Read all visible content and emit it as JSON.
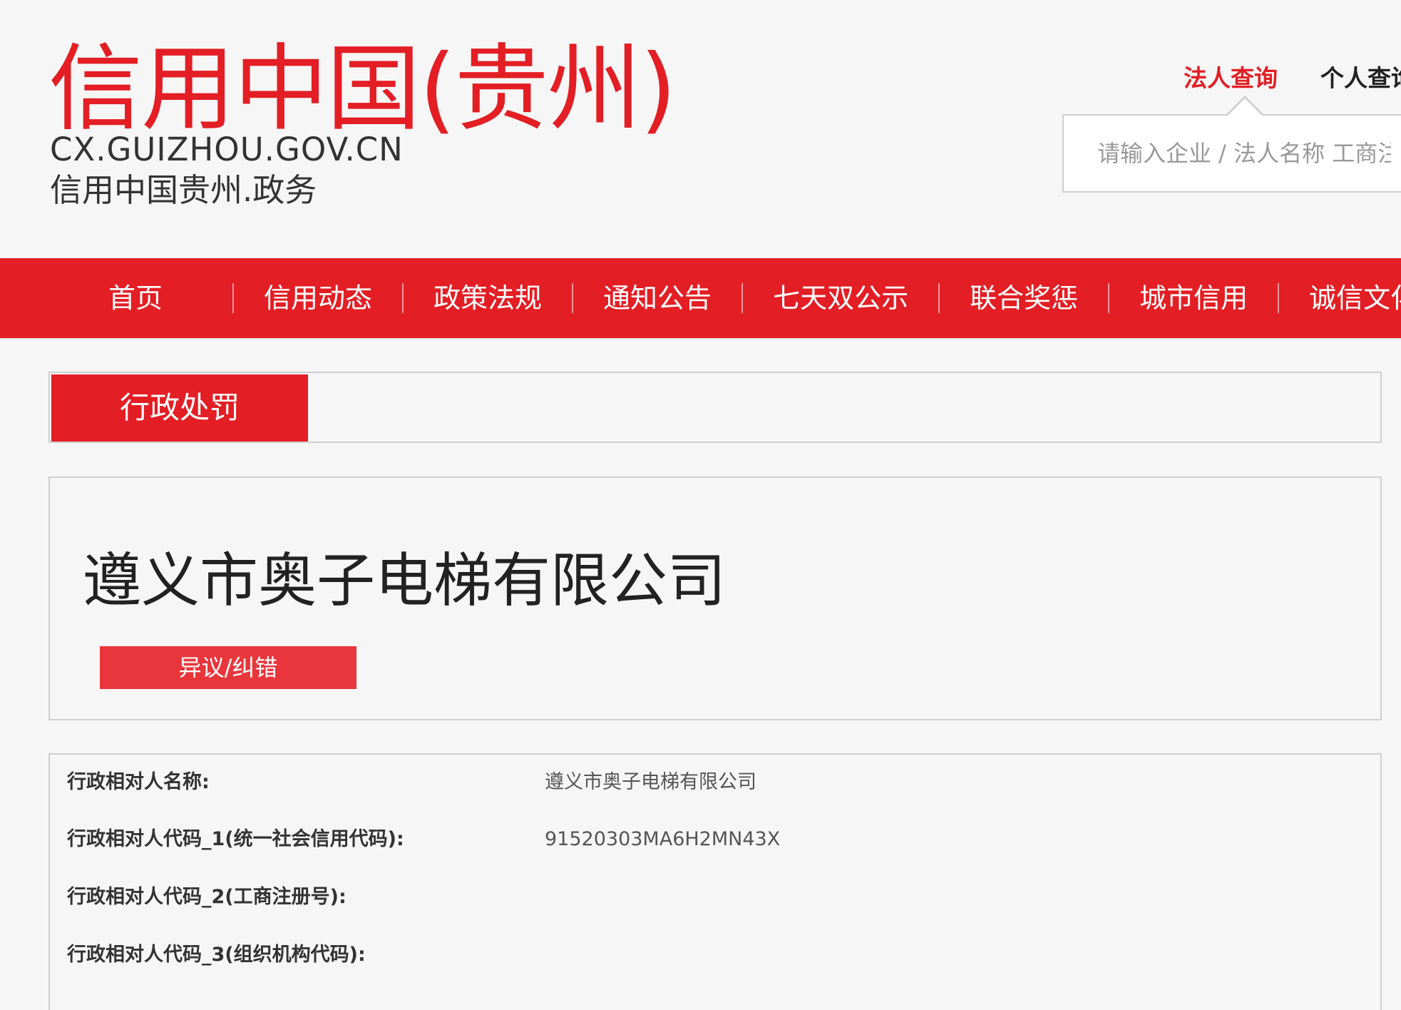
{
  "header": {
    "logo_title": "信用中国(贵州)",
    "logo_domain": "CX.GUIZHOU.GOV.CN",
    "logo_sub": "信用中国贵州.政务"
  },
  "search": {
    "tabs": [
      {
        "label": "法人查询",
        "active": true
      },
      {
        "label": "个人查询",
        "active": false
      }
    ],
    "placeholder": "请输入企业 / 法人名称 工商注册号"
  },
  "nav": {
    "items": [
      "首页",
      "信用动态",
      "政策法规",
      "通知公告",
      "七天双公示",
      "联合奖惩",
      "城市信用",
      "诚信文化"
    ]
  },
  "category": {
    "active_tab": "行政处罚"
  },
  "company": {
    "name": "遵义市奥子电梯有限公司",
    "objection_label": "异议/纠错"
  },
  "details": [
    {
      "label": "行政相对人名称:",
      "value": "遵义市奥子电梯有限公司"
    },
    {
      "label": "行政相对人代码_1(统一社会信用代码):",
      "value": "91520303MA6H2MN43X"
    },
    {
      "label": "行政相对人代码_2(工商注册号):",
      "value": ""
    },
    {
      "label": "行政相对人代码_3(组织机构代码):",
      "value": ""
    }
  ],
  "colors": {
    "brand_red": "#e31e24",
    "button_red": "#e8363c",
    "background": "#f6f6f6",
    "border": "#cfcfcf"
  }
}
